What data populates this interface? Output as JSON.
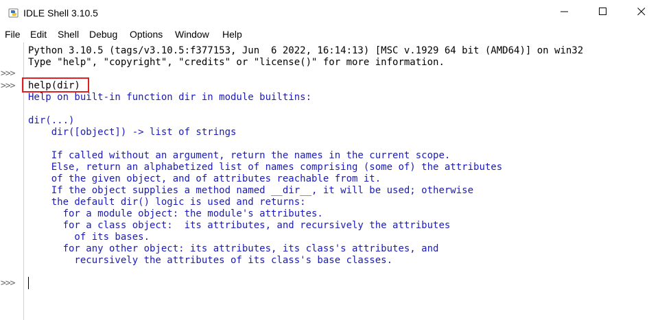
{
  "window": {
    "title": "IDLE Shell 3.10.5"
  },
  "menu": [
    "File",
    "Edit",
    "Shell",
    "Debug",
    "Options",
    "Window",
    "Help"
  ],
  "sidebar": {
    "prompts": [
      ">>>",
      ">>>",
      ">>>"
    ]
  },
  "shell": {
    "banner": [
      "Python 3.10.5 (tags/v3.10.5:f377153, Jun  6 2022, 16:14:13) [MSC v.1929 64 bit (AMD64)] on win32",
      "Type \"help\", \"copyright\", \"credits\" or \"license()\" for more information."
    ],
    "command": "help(dir)",
    "output": [
      "Help on built-in function dir in module builtins:",
      "",
      "dir(...)",
      "    dir([object]) -> list of strings",
      "",
      "    If called without an argument, return the names in the current scope.",
      "    Else, return an alphabetized list of names comprising (some of) the attributes",
      "    of the given object, and of attributes reachable from it.",
      "    If the object supplies a method named __dir__, it will be used; otherwise",
      "    the default dir() logic is used and returns:",
      "      for a module object: the module's attributes.",
      "      for a class object:  its attributes, and recursively the attributes",
      "        of its bases.",
      "      for any other object: its attributes, its class's attributes, and",
      "        recursively the attributes of its class's base classes."
    ]
  },
  "icons": {
    "app": "python-idle-icon",
    "minimize": "minimize-icon",
    "maximize": "maximize-icon",
    "close": "close-icon"
  },
  "colors": {
    "output_text": "#1a1ab8",
    "highlight_box": "#e02020"
  }
}
